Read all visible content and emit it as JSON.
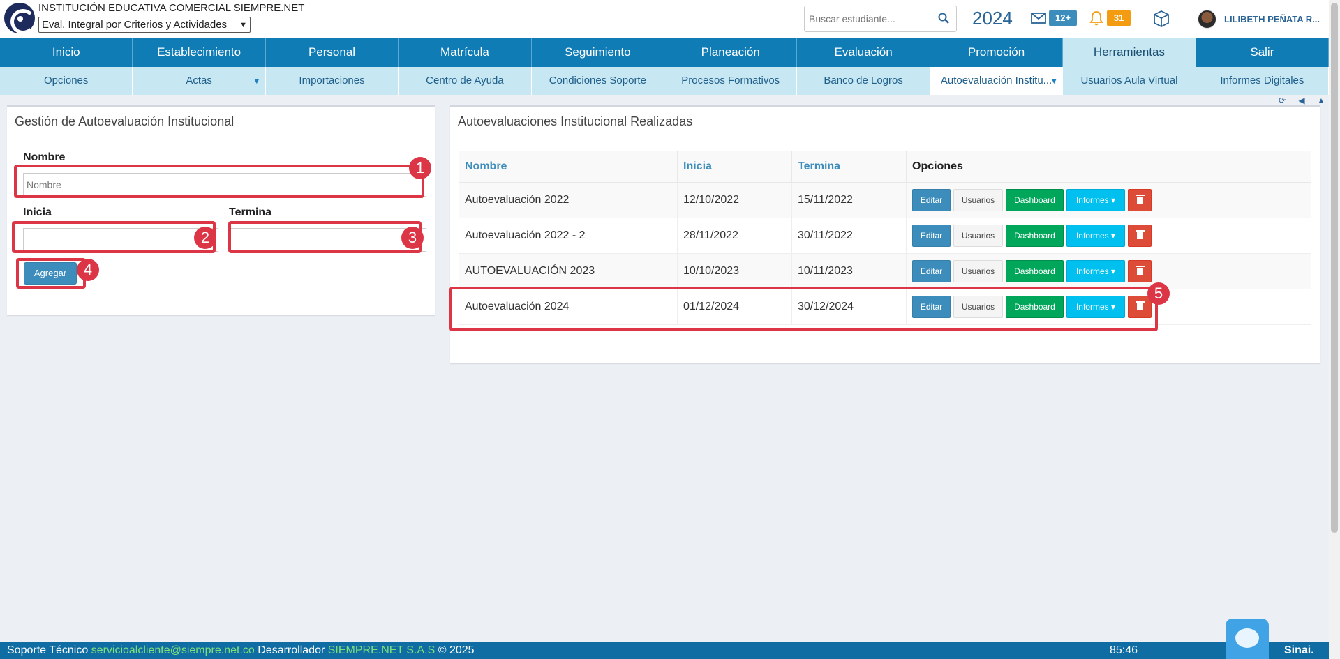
{
  "header": {
    "institution_name": "INSTITUCIÓN EDUCATIVA COMERCIAL SIEMPRE.NET",
    "period_selected": "Eval. Integral por Criterios y Actividades",
    "search_placeholder": "Buscar estudiante...",
    "year": "2024",
    "messages_badge": "12+",
    "notifications_badge": "31",
    "username": "LILIBETH PEÑATA R...",
    "icons": [
      "search-icon",
      "mail-icon",
      "bell-icon",
      "cube-icon"
    ]
  },
  "main_nav": [
    {
      "label": "Inicio"
    },
    {
      "label": "Establecimiento"
    },
    {
      "label": "Personal"
    },
    {
      "label": "Matrícula"
    },
    {
      "label": "Seguimiento"
    },
    {
      "label": "Planeación"
    },
    {
      "label": "Evaluación"
    },
    {
      "label": "Promoción"
    },
    {
      "label": "Herramientas",
      "active": true
    },
    {
      "label": "Salir"
    }
  ],
  "sub_nav": [
    {
      "label": "Opciones"
    },
    {
      "label": "Actas",
      "dropdown": true
    },
    {
      "label": "Importaciones"
    },
    {
      "label": "Centro de Ayuda"
    },
    {
      "label": "Condiciones Soporte"
    },
    {
      "label": "Procesos Formativos"
    },
    {
      "label": "Banco de Logros"
    },
    {
      "label": "Autoevaluación Institu...",
      "dropdown": true,
      "active": true
    },
    {
      "label": "Usuarios Aula Virtual"
    },
    {
      "label": "Informes Digitales"
    }
  ],
  "form_panel": {
    "title": "Gestión de Autoevaluación Institucional",
    "name_label": "Nombre",
    "name_placeholder": "Nombre",
    "start_label": "Inicia",
    "end_label": "Termina",
    "add_button": "Agregar"
  },
  "table_panel": {
    "title": "Autoevaluaciones Institucional Realizadas",
    "columns": [
      "Nombre",
      "Inicia",
      "Termina",
      "Opciones"
    ],
    "rows": [
      {
        "name": "Autoevaluación 2022",
        "start": "12/10/2022",
        "end": "15/11/2022"
      },
      {
        "name": "Autoevaluación 2022 - 2",
        "start": "28/11/2022",
        "end": "30/11/2022"
      },
      {
        "name": "AUTOEVALUACIÓN 2023",
        "start": "10/10/2023",
        "end": "10/11/2023"
      },
      {
        "name": "Autoevaluación 2024",
        "start": "01/12/2024",
        "end": "30/12/2024"
      }
    ],
    "row_buttons": {
      "edit": "Editar",
      "users": "Usuarios",
      "dashboard": "Dashboard",
      "reports": "Informes"
    }
  },
  "annotations": [
    "1",
    "2",
    "3",
    "4",
    "5"
  ],
  "footer": {
    "support_label": "Soporte Técnico",
    "support_email": "servicioalcliente@siempre.net.co",
    "developer_label": "Desarrollador",
    "developer_name": "SIEMPRE.NET S.A.S",
    "copyright": "© 2025",
    "timer": "85:46",
    "brand": "Sinai."
  },
  "colors": {
    "primary": "#0f7cb5",
    "subnav_bg": "#c7e7f2",
    "highlight": "#dc3545",
    "success": "#00a65a",
    "info": "#00c0ef",
    "danger": "#dd4b39"
  }
}
